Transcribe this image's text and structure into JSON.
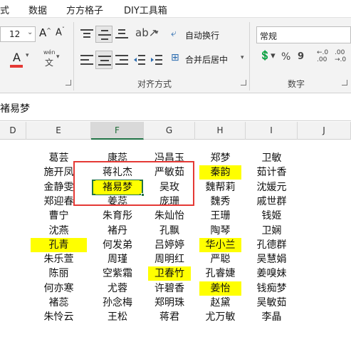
{
  "menu": [
    "式",
    "数据",
    "方方格子",
    "DIY工具箱"
  ],
  "ribbon": {
    "font_size": "12",
    "wrap_text": "自动换行",
    "merge_center": "合并后居中",
    "number_format": "常规",
    "alignment_group": "对齐方式",
    "number_group": "数字",
    "accent_color": "#e53935"
  },
  "formula_bar": {
    "value": "褚易梦"
  },
  "grid": {
    "columns": [
      "D",
      "E",
      "F",
      "G",
      "H",
      "I",
      "J"
    ],
    "active_column": "F",
    "active_cell": "F3",
    "highlight_color": "#ffff00",
    "rows": [
      [
        "",
        "葛芸",
        "康蕊",
        "冯昌玉",
        "郑梦",
        "卫敏",
        ""
      ],
      [
        "",
        "施开凤",
        "蒋礼杰",
        "严敏茹",
        "秦韵",
        "茹计香",
        ""
      ],
      [
        "",
        "金静雯",
        "褚易梦",
        "吴玫",
        "魏帮莉",
        "沈媛元",
        ""
      ],
      [
        "",
        "郑迎春",
        "姜蕊",
        "庞珊",
        "魏秀",
        "戚世群",
        ""
      ],
      [
        "",
        "曹宁",
        "朱育彤",
        "朱灿怡",
        "王珊",
        "钱姬",
        ""
      ],
      [
        "",
        "沈燕",
        "褚丹",
        "孔飘",
        "陶琴",
        "卫娴",
        ""
      ],
      [
        "",
        "孔青",
        "何发弟",
        "吕婷婷",
        "华小兰",
        "孔德群",
        ""
      ],
      [
        "",
        "朱乐萱",
        "周瑾",
        "周明红",
        "严聪",
        "吴慧娟",
        ""
      ],
      [
        "",
        "陈丽",
        "空紫霜",
        "卫春竹",
        "孔睿婕",
        "姜嗅妹",
        ""
      ],
      [
        "",
        "何亦寒",
        "尤蓉",
        "许碧香",
        "姜怡",
        "钱痴梦",
        ""
      ],
      [
        "",
        "褚蕊",
        "孙念梅",
        "郑明珠",
        "赵黛",
        "吴敏茹",
        ""
      ],
      [
        "",
        "朱怜云",
        "王松",
        "蒋君",
        "尤万敏",
        "李晶",
        ""
      ]
    ],
    "highlighted": [
      "H2",
      "F3",
      "E7",
      "H7",
      "G9",
      "H10"
    ]
  }
}
